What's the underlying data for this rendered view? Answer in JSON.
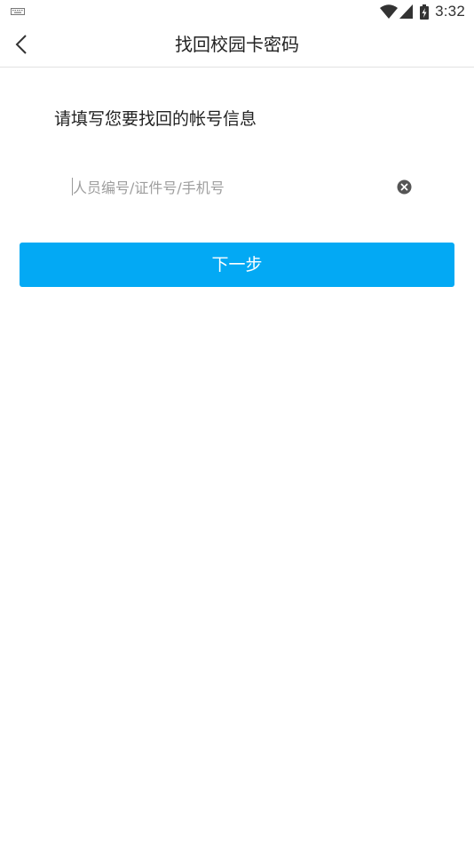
{
  "status_bar": {
    "time": "3:32",
    "icons": [
      "keyboard-icon",
      "wifi-icon",
      "signal-icon",
      "battery-charging-icon"
    ]
  },
  "toolbar": {
    "back_icon": "chevron-left-icon",
    "title": "找回校园卡密码"
  },
  "form": {
    "prompt": "请填写您要找回的帐号信息",
    "account_input": {
      "value": "",
      "placeholder": "人员编号/证件号/手机号"
    },
    "clear_icon": "clear-circle-icon",
    "next_label": "下一步"
  },
  "colors": {
    "accent": "#03a9f4",
    "title_text": "#222222",
    "placeholder_text": "#9e9e9e",
    "divider": "#e2e2e2",
    "clear_icon": "#555555"
  }
}
